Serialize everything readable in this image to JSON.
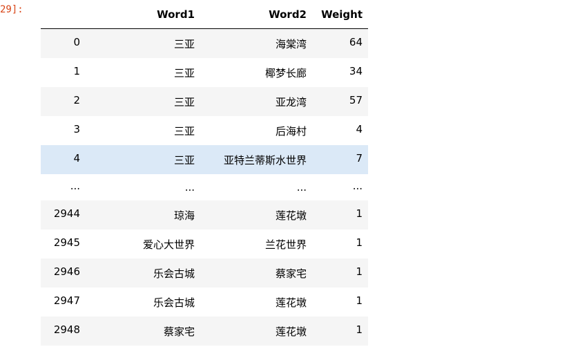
{
  "prompt": "29]:",
  "table": {
    "columns": [
      "",
      "Word1",
      "Word2",
      "Weight"
    ],
    "rows": [
      {
        "index": "0",
        "word1": "三亚",
        "word2": "海棠湾",
        "weight": "64"
      },
      {
        "index": "1",
        "word1": "三亚",
        "word2": "椰梦长廊",
        "weight": "34"
      },
      {
        "index": "2",
        "word1": "三亚",
        "word2": "亚龙湾",
        "weight": "57"
      },
      {
        "index": "3",
        "word1": "三亚",
        "word2": "后海村",
        "weight": "4"
      },
      {
        "index": "4",
        "word1": "三亚",
        "word2": "亚特兰蒂斯水世界",
        "weight": "7"
      },
      {
        "index": "...",
        "word1": "...",
        "word2": "...",
        "weight": "..."
      },
      {
        "index": "2944",
        "word1": "琼海",
        "word2": "莲花墩",
        "weight": "1"
      },
      {
        "index": "2945",
        "word1": "爱心大世界",
        "word2": "兰花世界",
        "weight": "1"
      },
      {
        "index": "2946",
        "word1": "乐会古城",
        "word2": "蔡家宅",
        "weight": "1"
      },
      {
        "index": "2947",
        "word1": "乐会古城",
        "word2": "莲花墩",
        "weight": "1"
      },
      {
        "index": "2948",
        "word1": "蔡家宅",
        "word2": "莲花墩",
        "weight": "1"
      }
    ]
  }
}
